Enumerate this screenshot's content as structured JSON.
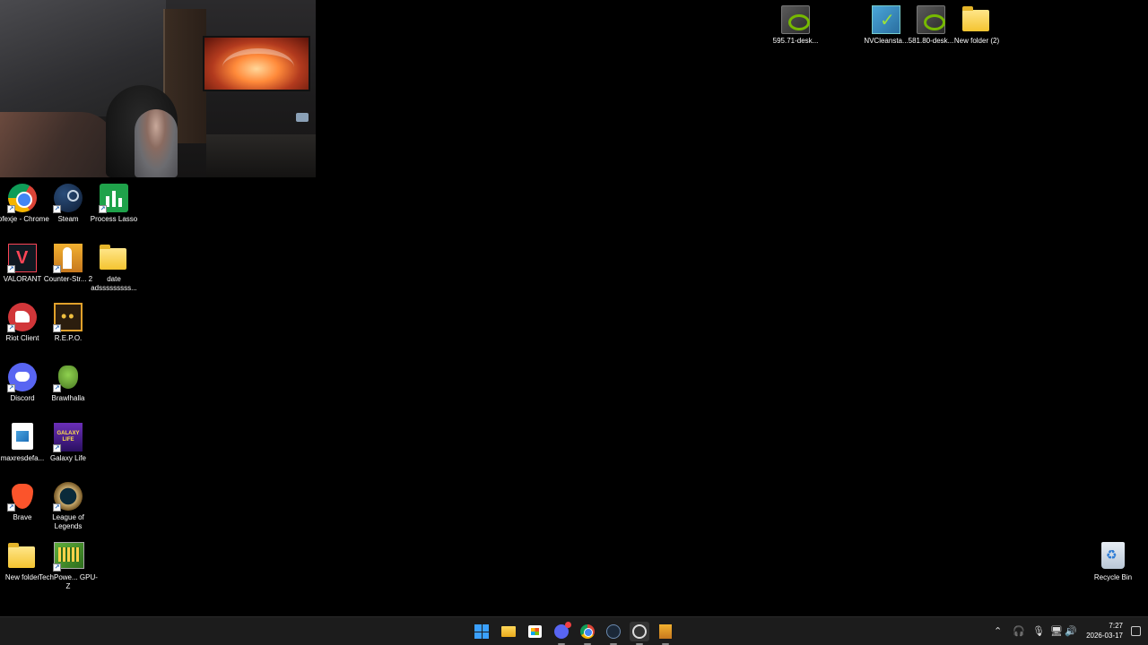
{
  "webcam": {
    "name": "webcam-overlay"
  },
  "desktop_icons_top": [
    {
      "name": "nvidia-driver-595",
      "label": "595.71-desk...",
      "icon": "nvidia-icon"
    },
    {
      "name": "nvcleanstall",
      "label": "NVCleansta...",
      "icon": "nvcleanstall-icon"
    },
    {
      "name": "nvidia-driver-581",
      "label": "581.80-desk...",
      "icon": "nvidia-icon"
    },
    {
      "name": "new-folder-2",
      "label": "New folder (2)",
      "icon": "folder-icon"
    }
  ],
  "desktop_icons_left": [
    {
      "label": "rofexje - Chrome",
      "icon": "chrome-icon"
    },
    {
      "label": "Steam",
      "icon": "steam-icon"
    },
    {
      "label": "Process Lasso",
      "icon": "process-lasso-icon"
    },
    {
      "label": "VALORANT",
      "icon": "valorant-icon"
    },
    {
      "label": "Counter-Str... 2",
      "icon": "counter-strike-icon"
    },
    {
      "label": "date adsssssssss...",
      "icon": "folder-icon"
    },
    {
      "label": "Riot Client",
      "icon": "riot-client-icon"
    },
    {
      "label": "R.E.P.O.",
      "icon": "repo-icon"
    },
    {
      "label": "Discord",
      "icon": "discord-icon"
    },
    {
      "label": "Brawlhalla",
      "icon": "brawlhalla-icon"
    },
    {
      "label": "maxresdefa...",
      "icon": "image-file-icon"
    },
    {
      "label": "Galaxy Life",
      "icon": "galaxy-life-icon"
    },
    {
      "label": "Brave",
      "icon": "brave-icon"
    },
    {
      "label": "League of Legends",
      "icon": "league-of-legends-icon"
    },
    {
      "label": "New folder",
      "icon": "folder-icon"
    },
    {
      "label": "TechPowe... GPU-Z",
      "icon": "gpu-z-icon"
    }
  ],
  "recycle_bin": {
    "label": "Recycle Bin",
    "icon": "recycle-bin-icon"
  },
  "taskbar": {
    "apps": [
      "start",
      "file-explorer",
      "microsoft-store",
      "discord",
      "chrome",
      "steam",
      "obs",
      "counter-strike-2"
    ],
    "tray_icons": [
      "chevron-up-icon",
      "headset-icon",
      "microphone-icon",
      "network-icon",
      "volume-icon"
    ],
    "time": "7:27",
    "date": "2026-03-17"
  }
}
